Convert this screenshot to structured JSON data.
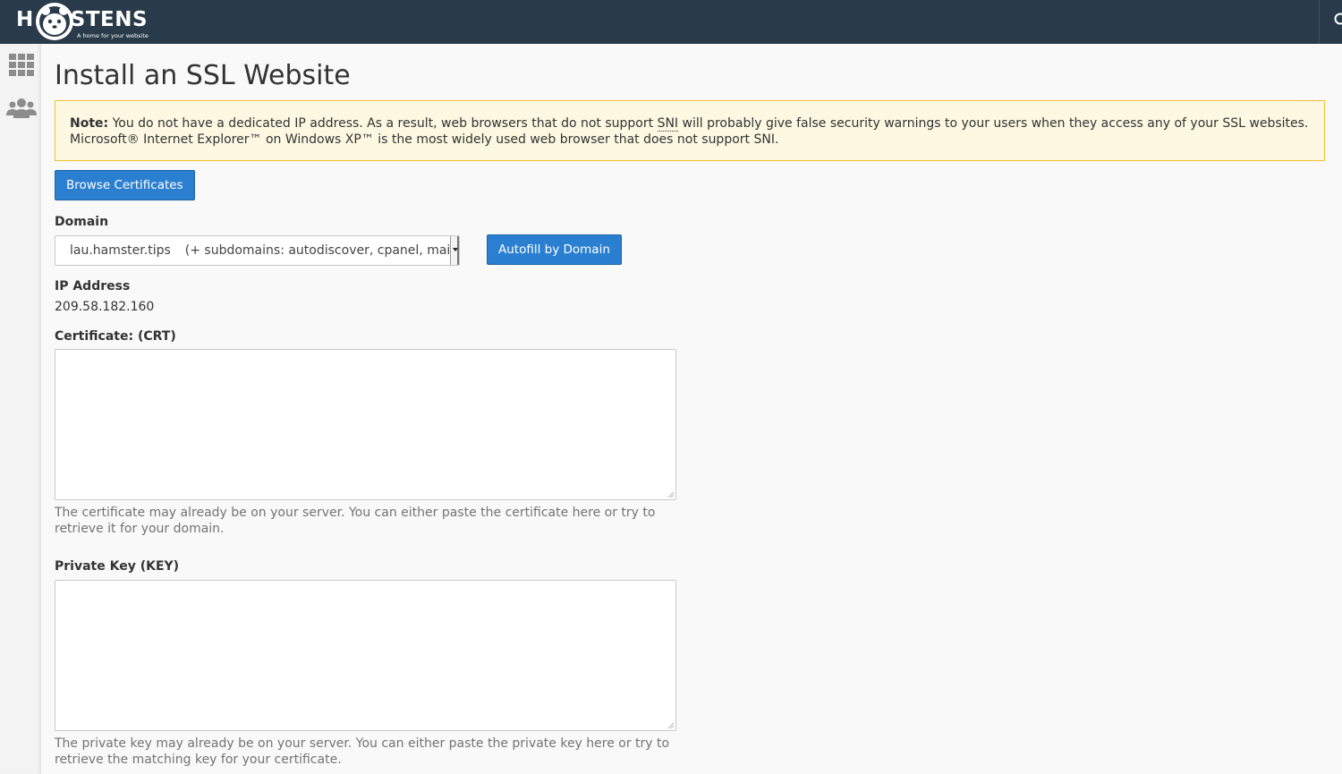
{
  "header": {
    "logo_text": "HOSTENS",
    "logo_left": "H",
    "logo_right": "STENS",
    "logo_tagline": "A home for your website"
  },
  "sidebar": {
    "items": [
      {
        "icon": "grid-icon"
      },
      {
        "icon": "users-icon"
      }
    ]
  },
  "page": {
    "title": "Install an SSL Website"
  },
  "alert": {
    "note_label": "Note:",
    "text_before_sni": " You do not have a dedicated IP address. As a result, web browsers that do not support ",
    "sni": "SNI",
    "text_after_sni": " will probably give false security warnings to your users when they access any of your SSL websites.",
    "line2": "Microsoft® Internet Explorer™ on Windows XP™ is the most widely used web browser that does not support SNI."
  },
  "buttons": {
    "browse": "Browse Certificates",
    "autofill": "Autofill by Domain"
  },
  "form": {
    "domain_label": "Domain",
    "domain_value": "lau.hamster.tips",
    "domain_subdomains": "(+ subdomains: autodiscover, cpanel, mail,",
    "ip_label": "IP Address",
    "ip_value": "209.58.182.160",
    "crt_label": "Certificate: (CRT)",
    "crt_value": "",
    "crt_help": "The certificate may already be on your server. You can either paste the certificate here or try to retrieve it for your domain.",
    "key_label": "Private Key (KEY)",
    "key_value": "",
    "key_help": "The private key may already be on your server. You can either paste the private key here or try to retrieve the matching key for your certificate."
  },
  "colors": {
    "topbar": "#293a4a",
    "primary_button": "#2b7fd0",
    "alert_bg": "#fcf8e1",
    "alert_border": "#f6bf2e"
  }
}
